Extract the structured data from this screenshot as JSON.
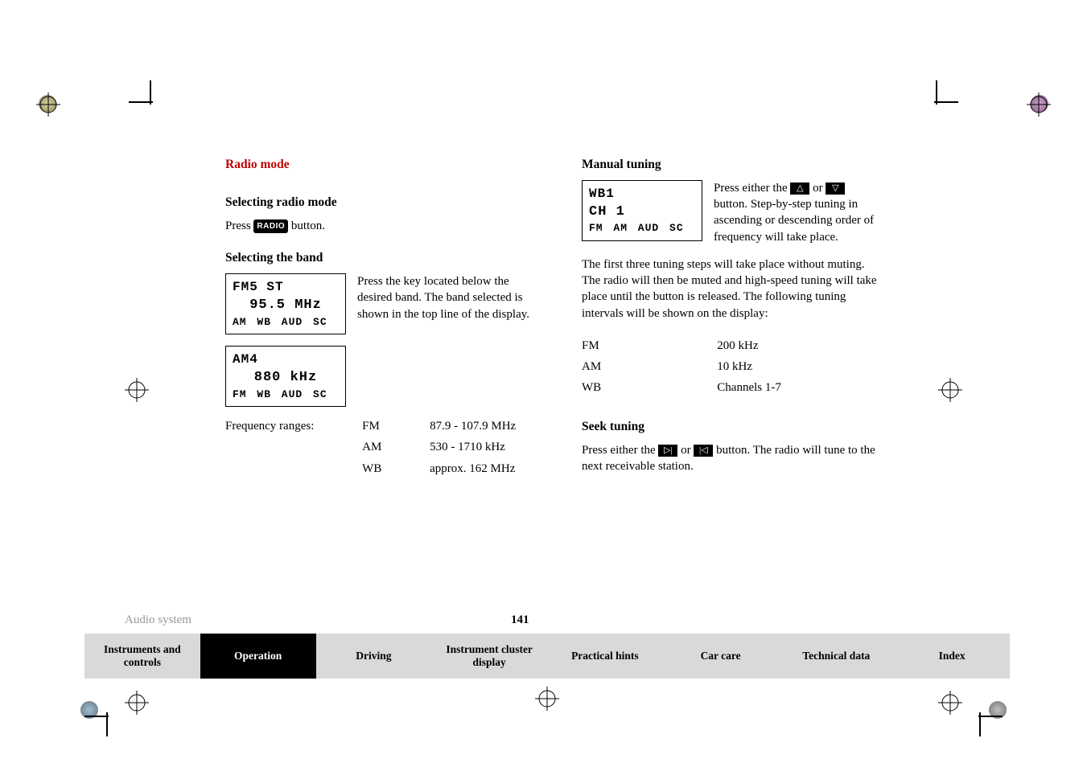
{
  "headings": {
    "radio_mode": "Radio mode",
    "selecting_mode": "Selecting radio mode",
    "selecting_band": "Selecting the band",
    "manual_tuning": "Manual tuning",
    "seek_tuning": "Seek tuning"
  },
  "text": {
    "press_radio": "Press ",
    "button_suffix": " button.",
    "radio_label": "RADIO",
    "band_desc": "Press the key located below the desired band. The band selected is shown in the top line of the display.",
    "freq_ranges_label": "Frequency ranges:",
    "manual_intro_a": "Press either the ",
    "manual_intro_b": " or ",
    "manual_intro_c": " button. Step-by-step tuning in ascending or descending order of frequency will take place.",
    "manual_body": "The first three tuning steps will take place without muting. The radio will then be muted and high-speed tuning will take place until the button is released. The following tuning intervals will be shown on the display:",
    "seek_a": "Press either the ",
    "seek_b": " or ",
    "seek_c": " button. The radio will tune to the next receivable station."
  },
  "lcd": {
    "fm": {
      "line1": "FM5  ST",
      "line2": "95.5 MHz",
      "line3": "AM WB AUD SC"
    },
    "am": {
      "line1": "AM4",
      "line2": "880 kHz",
      "line3": "FM WB AUD SC"
    },
    "wb": {
      "line1": "WB1",
      "line2": "CH 1",
      "line3": "FM AM AUD SC"
    }
  },
  "freq_ranges": {
    "fm_label": "FM",
    "fm_val": "87.9 - 107.9 MHz",
    "am_label": "AM",
    "am_val": "530 - 1710 kHz",
    "wb_label": "WB",
    "wb_val": "approx. 162 MHz"
  },
  "intervals": {
    "fm_label": "FM",
    "fm_val": "200 kHz",
    "am_label": "AM",
    "am_val": "10 kHz",
    "wb_label": "WB",
    "wb_val": "Channels 1-7"
  },
  "footer": {
    "section": "Audio system",
    "page": "141",
    "tabs": {
      "t1": "Instruments and controls",
      "t2": "Operation",
      "t3": "Driving",
      "t4": "Instrument cluster display",
      "t5": "Practical hints",
      "t6": "Car care",
      "t7": "Technical data",
      "t8": "Index"
    }
  }
}
